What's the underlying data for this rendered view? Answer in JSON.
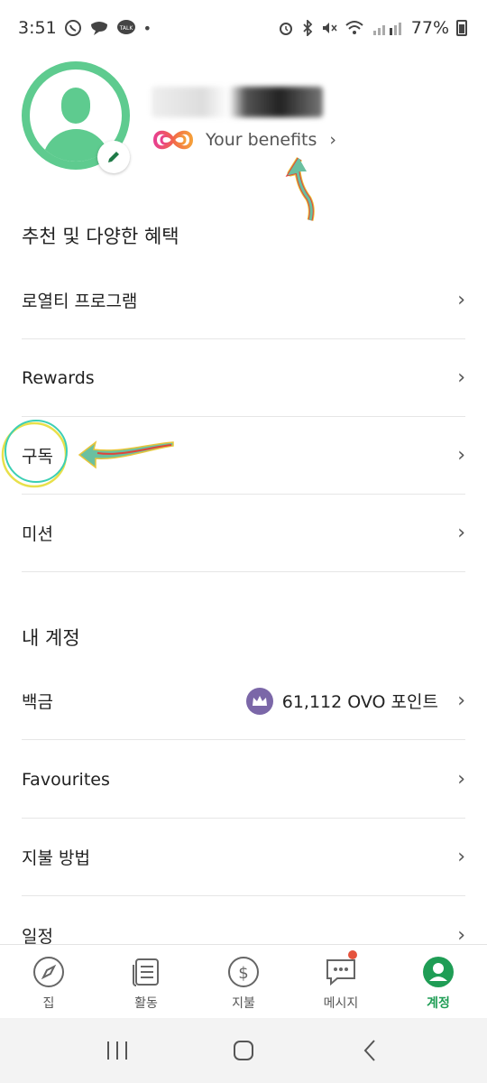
{
  "status_bar": {
    "time": "3:51",
    "battery": "77%",
    "left_icons": [
      "whatsapp-icon",
      "chat-icon",
      "talk-icon",
      "dot-icon"
    ],
    "right_icons": [
      "alarm-icon",
      "bluetooth-icon",
      "mute-icon",
      "wifi-icon",
      "signal-icon"
    ]
  },
  "profile": {
    "benefits_label": "Your benefits"
  },
  "sections": {
    "recommended_title": "추천 및 다양한 혜택",
    "account_title": "내 계정"
  },
  "menu": {
    "loyalty": "로열티 프로그램",
    "rewards": "Rewards",
    "subscription": "구독",
    "missions": "미션",
    "platinum": "백금",
    "points": "61,112 OVO 포인트",
    "favourites": "Favourites",
    "payment_methods": "지불 방법",
    "schedule": "일정"
  },
  "nav": {
    "home": "집",
    "activity": "활동",
    "payment": "지불",
    "messages": "메시지",
    "account": "계정"
  },
  "colors": {
    "brand_green": "#5ecb8f",
    "active_green": "#1f9d55",
    "points_purple": "#7b67a8",
    "notification_red": "#e5533d"
  }
}
